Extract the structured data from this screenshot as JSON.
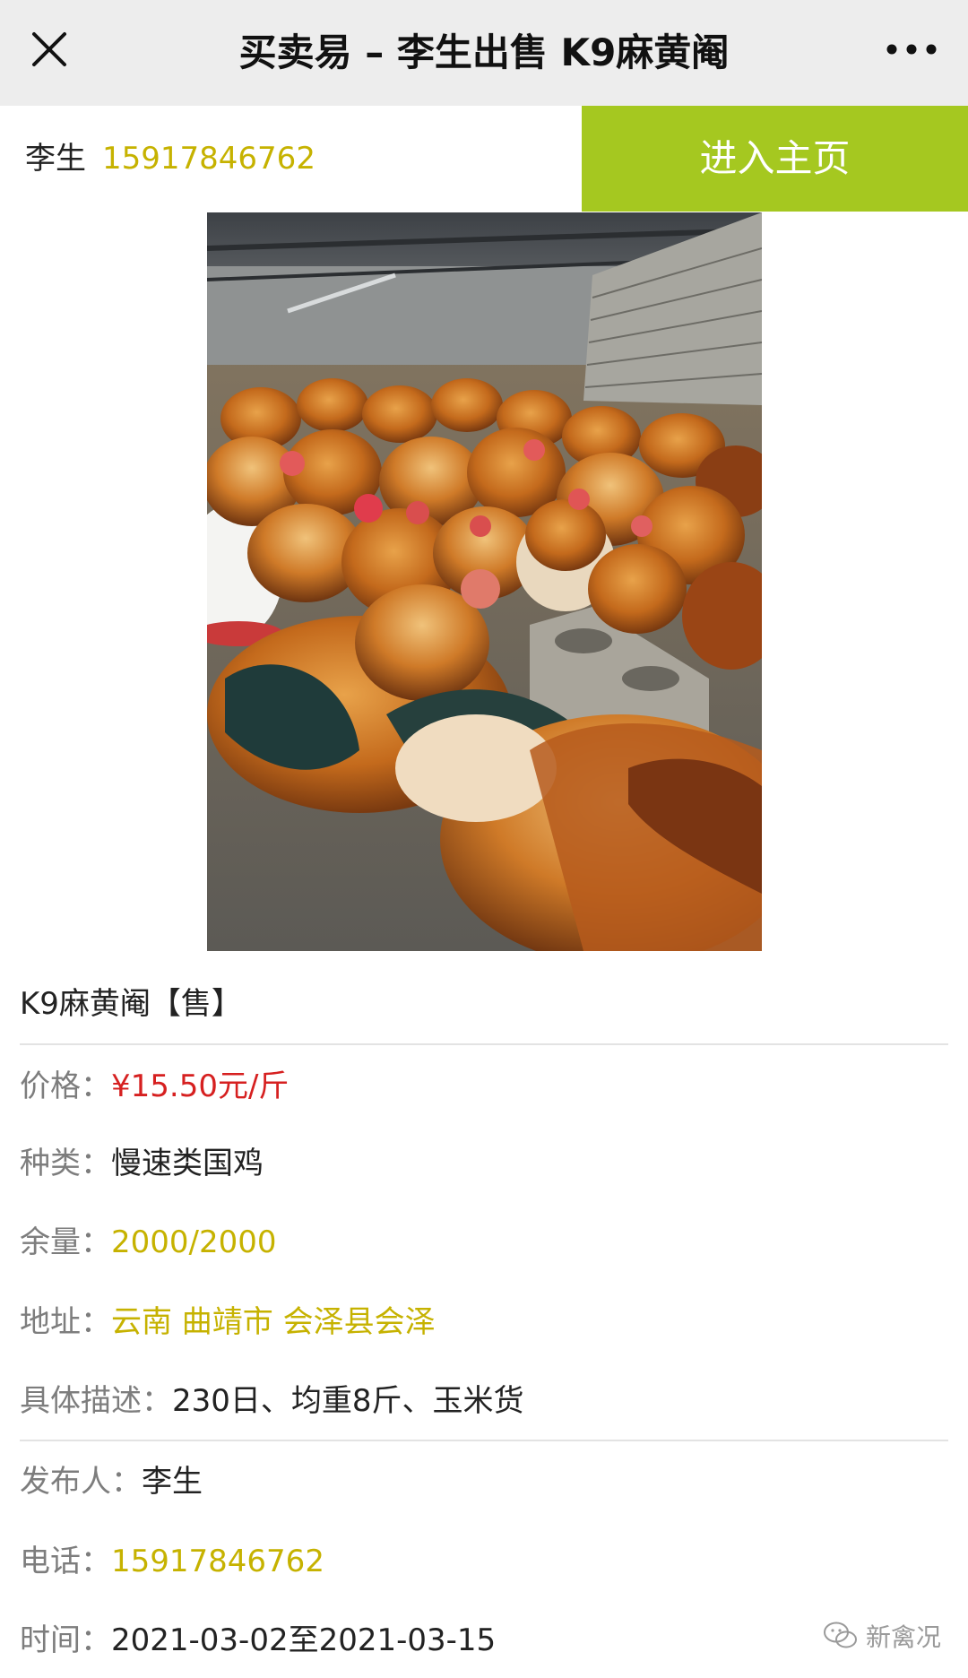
{
  "navbar": {
    "title": "买卖易 – 李生出售 K9麻黄阉",
    "close_icon": "close-icon",
    "more_icon": "more-dots-icon"
  },
  "seller": {
    "name": "李生",
    "phone": "15917846762",
    "home_button_label": "进入主页"
  },
  "listing": {
    "title": "K9麻黄阉【售】",
    "price": {
      "label": "价格：",
      "value": "¥15.50元/斤"
    },
    "category": {
      "label": "种类：",
      "value": "慢速类国鸡"
    },
    "stock": {
      "label": "余量：",
      "value": "2000/2000"
    },
    "address": {
      "label": "地址：",
      "value": "云南 曲靖市 会泽县会泽"
    },
    "description": {
      "label": "具体描述：",
      "value": "230日、均重8斤、玉米货"
    },
    "publisher": {
      "label": "发布人：",
      "value": "李生"
    },
    "phone": {
      "label": "电话：",
      "value": "15917846762"
    },
    "time": {
      "label": "时间：",
      "value": "2021-03-02至2021-03-15"
    }
  },
  "watermark": {
    "text": "新禽况",
    "icon": "wechat-icon"
  },
  "colors": {
    "accent_green": "#a5c820",
    "phone_yellow": "#c6b200",
    "price_red": "#d62020",
    "navbar_bg": "#ededed"
  }
}
